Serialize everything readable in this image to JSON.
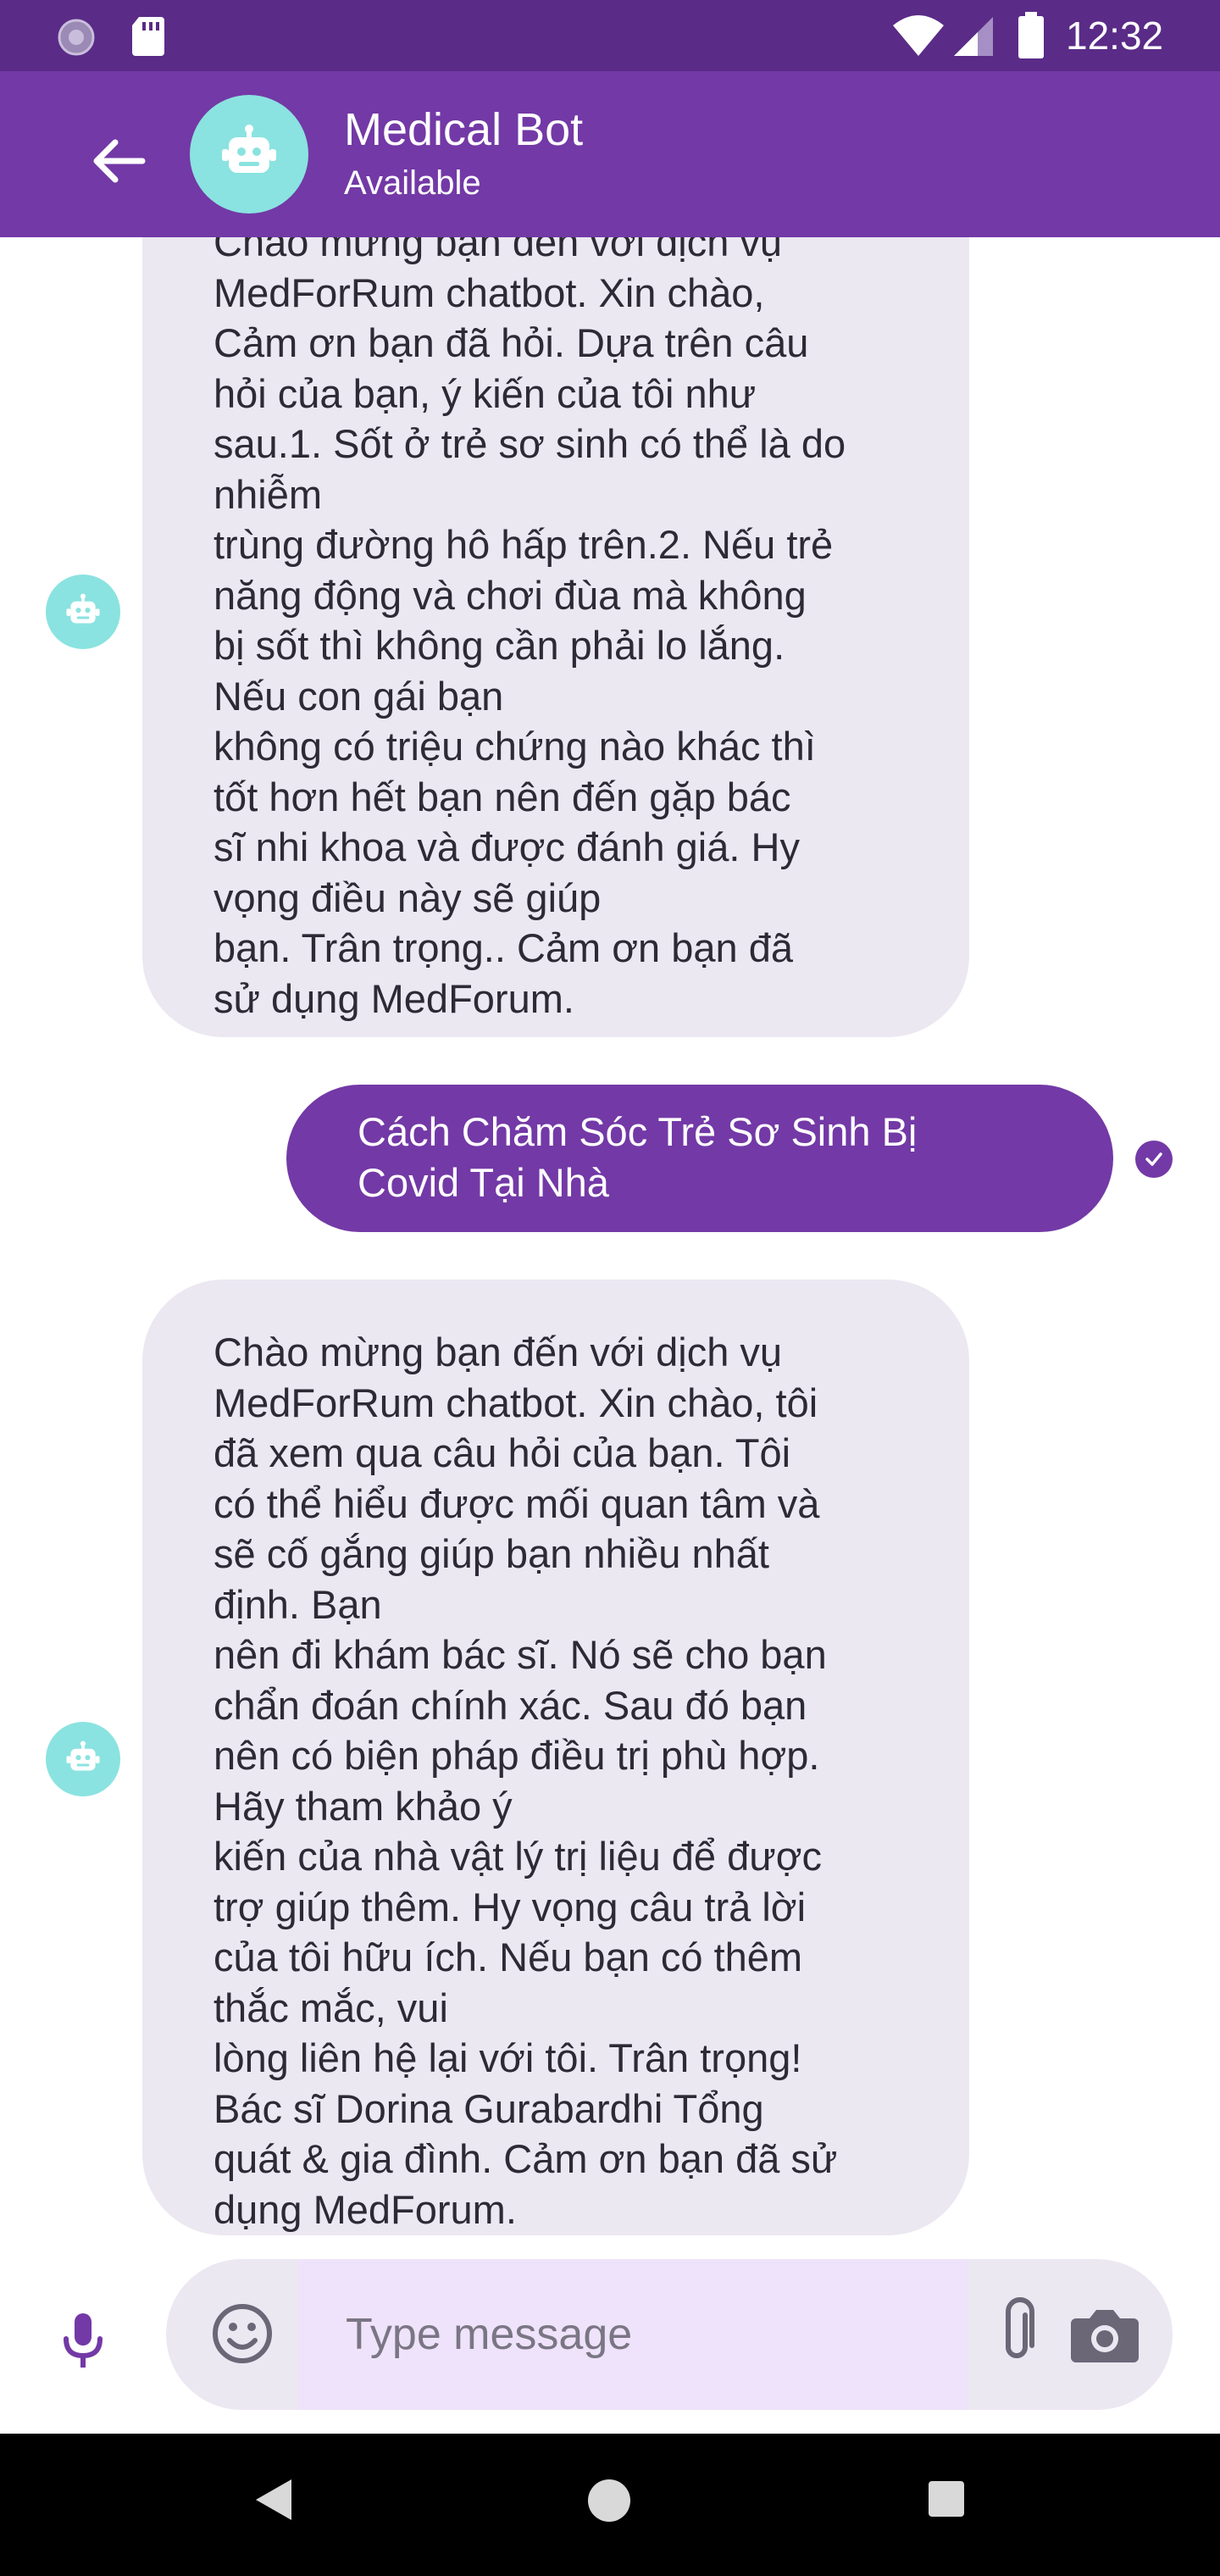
{
  "status_bar": {
    "time": "12:32",
    "icons": [
      "notification-icon",
      "sd-card-icon",
      "wifi-icon",
      "signal-icon",
      "battery-icon"
    ]
  },
  "header": {
    "title": "Medical Bot",
    "status": "Available",
    "icons": [
      "back-arrow-icon",
      "robot-avatar-icon"
    ]
  },
  "messages": [
    {
      "sender": "bot",
      "text": "Chào mừng bạn đến với dịch vụ\nMedForRum chatbot. Xin chào,\nCảm ơn bạn đã hỏi. Dựa trên câu\nhỏi của bạn, ý kiến của tôi như\nsau.1. Sốt ở trẻ sơ sinh có thể là do\nnhiễm\ntrùng đường hô hấp trên.2. Nếu trẻ\nnăng động và chơi đùa mà không\nbị sốt thì không cần phải lo lắng.\nNếu con gái bạn\nkhông có triệu chứng nào khác thì\ntốt hơn hết bạn nên đến gặp bác\nsĩ nhi khoa và được đánh giá. Hy\nvọng điều này sẽ giúp\nbạn. Trân trọng.. Cảm ơn bạn đã\nsử dụng MedForum."
    },
    {
      "sender": "user",
      "text": "Cách Chăm Sóc Trẻ Sơ Sinh Bị\nCovid Tại Nhà",
      "status": "sent"
    },
    {
      "sender": "bot",
      "text": "Chào mừng bạn đến với dịch vụ\nMedForRum chatbot. Xin chào, tôi\nđã xem qua câu hỏi của bạn. Tôi\ncó thể hiểu được mối quan tâm và\nsẽ cố gắng giúp bạn nhiều nhất\nđịnh. Bạn\nnên đi khám bác sĩ. Nó sẽ cho bạn\nchẩn đoán chính xác. Sau đó bạn\nnên có biện pháp điều trị phù hợp.\nHãy tham khảo ý\nkiến của nhà vật lý trị liệu để được\ntrợ giúp thêm. Hy vọng câu trả lời\ncủa tôi hữu ích. Nếu bạn có thêm\nthắc mắc, vui\nlòng liên hệ lại với tôi. Trân trọng!\nBác sĩ Dorina Gurabardhi Tổng\nquát & gia đình. Cảm ơn bạn đã sử\ndụng MedForum."
    }
  ],
  "input": {
    "placeholder": "Type message",
    "value": "",
    "icons": [
      "mic-icon",
      "emoji-icon",
      "attach-icon",
      "camera-icon"
    ]
  },
  "nav_bar": {
    "icons": [
      "nav-back-icon",
      "nav-home-icon",
      "nav-recents-icon"
    ]
  },
  "colors": {
    "status_bar": "#5a2b87",
    "header": "#7339a6",
    "avatar": "#8ae3e0",
    "bot_bubble": "#ece8f2",
    "user_bubble": "#7339a6",
    "input_field": "#efe3fb"
  }
}
